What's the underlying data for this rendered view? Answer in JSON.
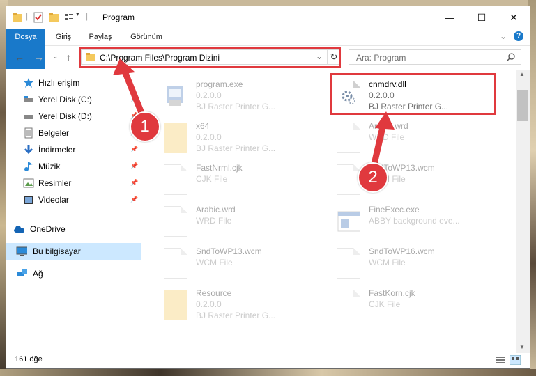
{
  "window": {
    "title": "Program",
    "minimize": "—",
    "maximize": "☐",
    "close": "✕"
  },
  "ribbon": {
    "tabs": [
      "Dosya",
      "Giriş",
      "Paylaş",
      "Görünüm"
    ]
  },
  "nav": {
    "address": "C:\\Program Files\\Program Dizini",
    "search_placeholder": "Ara: Program"
  },
  "sidebar": {
    "items": [
      {
        "label": "Hızlı erişim",
        "icon": "star-icon"
      },
      {
        "label": "Yerel Disk (C:)",
        "icon": "drive-icon"
      },
      {
        "label": "Yerel Disk (D:)",
        "icon": "drive-icon"
      },
      {
        "label": "Belgeler",
        "icon": "documents-icon"
      },
      {
        "label": "İndirmeler",
        "icon": "download-icon"
      },
      {
        "label": "Müzik",
        "icon": "music-icon"
      },
      {
        "label": "Resimler",
        "icon": "pictures-icon"
      },
      {
        "label": "Videolar",
        "icon": "video-icon"
      },
      {
        "label": "OneDrive",
        "icon": "cloud-icon"
      },
      {
        "label": "Bu bilgisayar",
        "icon": "computer-icon"
      },
      {
        "label": "Ağ",
        "icon": "network-icon"
      }
    ]
  },
  "files": [
    {
      "name": "program.exe",
      "line1": "0.2.0.0",
      "line2": "BJ Raster Printer G..."
    },
    {
      "name": "cnmdrv.dll",
      "line1": "0.2.0.0",
      "line2": "BJ Raster Printer G..."
    },
    {
      "name": "x64",
      "line1": "0.2.0.0",
      "line2": "BJ Raster Printer G..."
    },
    {
      "name": "Arabic.wrd",
      "line1": "WRD File",
      "line2": ""
    },
    {
      "name": "FastNrml.cjk",
      "line1": "CJK File",
      "line2": ""
    },
    {
      "name": "SndToWP13.wcm",
      "line1": "WCM File",
      "line2": ""
    },
    {
      "name": "Arabic.wrd",
      "line1": "WRD File",
      "line2": ""
    },
    {
      "name": "FineExec.exe",
      "line1": "ABBY background eve...",
      "line2": ""
    },
    {
      "name": "SndToWP13.wcm",
      "line1": "WCM File",
      "line2": ""
    },
    {
      "name": "SndToWP16.wcm",
      "line1": "WCM File",
      "line2": ""
    },
    {
      "name": "Resource",
      "line1": "0.2.0.0",
      "line2": "BJ Raster Printer G..."
    },
    {
      "name": "FastKorn.cjk",
      "line1": "CJK File",
      "line2": ""
    }
  ],
  "status": {
    "count": "161 öğe"
  },
  "annotations": {
    "badge1": "1",
    "badge2": "2"
  },
  "colors": {
    "accent": "#1979ca",
    "highlight": "#e0393e",
    "selected": "#cce8ff"
  }
}
